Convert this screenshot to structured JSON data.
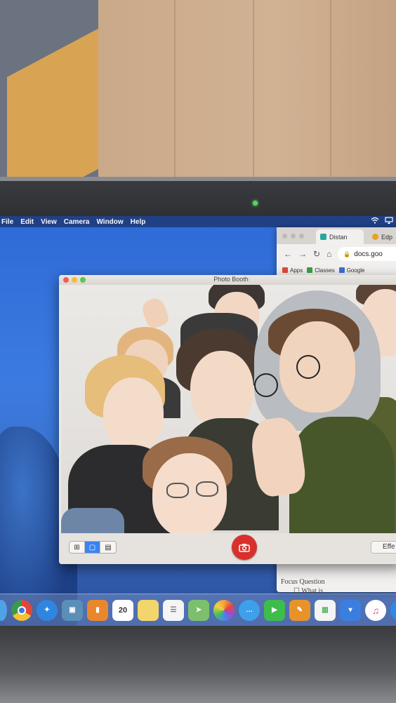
{
  "menubar": {
    "items": [
      "File",
      "Edit",
      "View",
      "Camera",
      "Window",
      "Help"
    ]
  },
  "browser": {
    "tabs": [
      {
        "label": "Distan",
        "color": "#2aa7a0"
      },
      {
        "label": "Edp",
        "color": "#e8a21e"
      }
    ],
    "url": "docs.goo",
    "bookmarks": [
      {
        "label": "Apps",
        "color": "#e04b3c"
      },
      {
        "label": "Classes",
        "color": "#3aa046"
      },
      {
        "label": "Google",
        "color": "#3b6fd8"
      }
    ],
    "doc_heading": "Focus Question",
    "doc_line": "What is"
  },
  "photo_booth": {
    "title": "Photo Booth",
    "effects_label": "Effe",
    "view_modes": [
      "grid",
      "single",
      "strip"
    ],
    "selected_view": "single"
  },
  "colors": {
    "close": "#ec5f57",
    "minimize": "#f5bd34",
    "zoom": "#5ec74c",
    "shutter": "#d8302c",
    "selected": "#3b83f0"
  },
  "dock": {
    "icons": [
      {
        "name": "finder-icon",
        "color": "#4ea3e6"
      },
      {
        "name": "chrome-icon",
        "color": "#3a9a4a"
      },
      {
        "name": "safari-icon",
        "color": "#2f86e0"
      },
      {
        "name": "preview-icon",
        "color": "#5a8fb8"
      },
      {
        "name": "ibooks-icon",
        "color": "#e8872c"
      },
      {
        "name": "calendar-icon",
        "color": "#ffffff",
        "text": "20"
      },
      {
        "name": "notes-icon",
        "color": "#f3d66b"
      },
      {
        "name": "reminders-icon",
        "color": "#f5f5f5"
      },
      {
        "name": "maps-icon",
        "color": "#7cc06d"
      },
      {
        "name": "photos-icon",
        "color": "#f2a33a"
      },
      {
        "name": "messages-icon",
        "color": "#3fa0ea"
      },
      {
        "name": "facetime-icon",
        "color": "#3ebc4c"
      },
      {
        "name": "pages-icon",
        "color": "#e8932a"
      },
      {
        "name": "numbers-icon",
        "color": "#3dab4b"
      },
      {
        "name": "keynote-icon",
        "color": "#3a7fe0"
      },
      {
        "name": "itunes-icon",
        "color": "#e54b8a"
      },
      {
        "name": "app-store-icon",
        "color": "#2c8be6"
      }
    ]
  }
}
